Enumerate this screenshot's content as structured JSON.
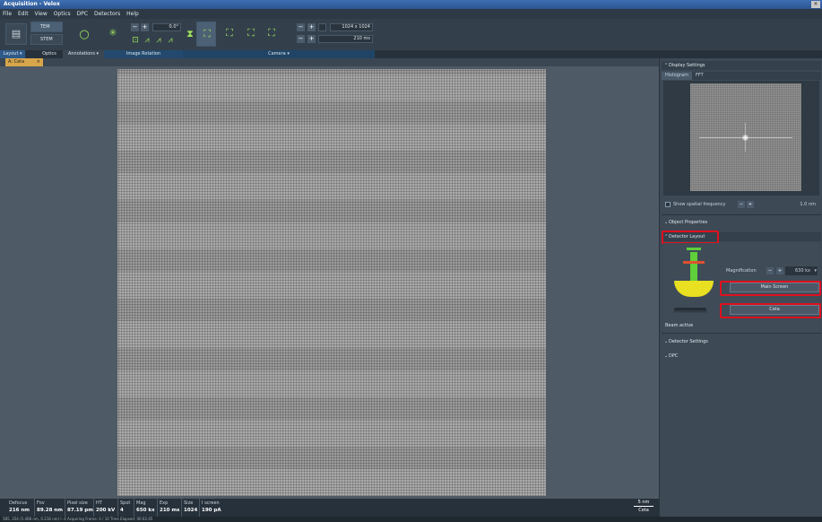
{
  "window": {
    "title": "Acquisition - Velox",
    "close": "✕"
  },
  "menu": [
    "File",
    "Edit",
    "View",
    "Optics",
    "DPC",
    "Detectors",
    "Help"
  ],
  "ribbon": {
    "modes": [
      "TEM",
      "STEM"
    ],
    "rotation_value": "0.0°",
    "camera_size": "1024 x 1024",
    "exposure": "210 ms",
    "groups": [
      "Layout ▾",
      "Optics",
      "Annotations ▾",
      "Image Rotation",
      "Camera ▾"
    ]
  },
  "tab": {
    "label": "A: Ceta",
    "close": "×"
  },
  "display_settings": {
    "header": "Display Settings",
    "tabs": [
      "Histogram",
      "FFT"
    ],
    "spatial_label": "Show spatial frequency",
    "spatial_value": "1.0 nm"
  },
  "object_properties": {
    "header": "Object Properties"
  },
  "detector_layout": {
    "header": "Detector Layout",
    "magnification_label": "Magnification",
    "magnification_value": "630 kx",
    "main_screen": "Main Screen",
    "ceta": "Ceta",
    "beam_status": "Beam active"
  },
  "detector_settings": {
    "header": "Detector Settings"
  },
  "dpc": {
    "header": "DPC"
  },
  "status": {
    "columns": [
      {
        "h": "Defocus",
        "v": "216 nm"
      },
      {
        "h": "Fov",
        "v": "89.28 nm"
      },
      {
        "h": "Pixel size",
        "v": "87.19 pm"
      },
      {
        "h": "HT",
        "v": "200 kV"
      },
      {
        "h": "Spot",
        "v": "4"
      },
      {
        "h": "Mag",
        "v": "650 kx"
      },
      {
        "h": "Exp",
        "v": "210 ms"
      },
      {
        "h": "Size",
        "v": "1024"
      },
      {
        "h": "I screen",
        "v": "190 pA"
      }
    ],
    "scale_label": "5 nm",
    "detector": "Ceta"
  },
  "statusline": "585, 354 (5.408 nm, 0.218 nm) I -4    Acquiring Frame: 0 / 10  Time Elapsed: 00:02:45",
  "colors": {
    "accent": "#3f6fb4",
    "highlight": "#e0101e",
    "tab": "#d7a54a"
  }
}
